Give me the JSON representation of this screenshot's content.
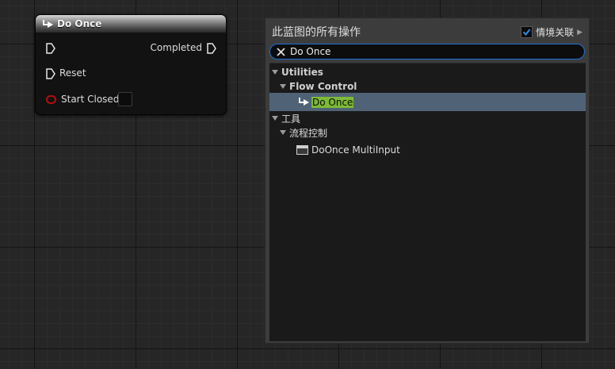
{
  "node": {
    "title": "Do Once",
    "pins": {
      "exec_in": "",
      "completed": "Completed",
      "reset": "Reset",
      "start_closed": "Start Closed"
    }
  },
  "menu": {
    "title": "此蓝图的所有操作",
    "context_label": "情境关联",
    "context_checked": true,
    "search_value": "Do Once",
    "tree": {
      "utilities": "Utilities",
      "flow_control": "Flow Control",
      "do_once": "Do Once",
      "tools": "工具",
      "flow_control_cn": "流程控制",
      "doonce_multi": "DoOnce MultiInput"
    }
  },
  "colors": {
    "accent": "#1f6fd6",
    "selection": "#506276",
    "highlight": "#7cba35",
    "bool_pin": "#b01010"
  }
}
